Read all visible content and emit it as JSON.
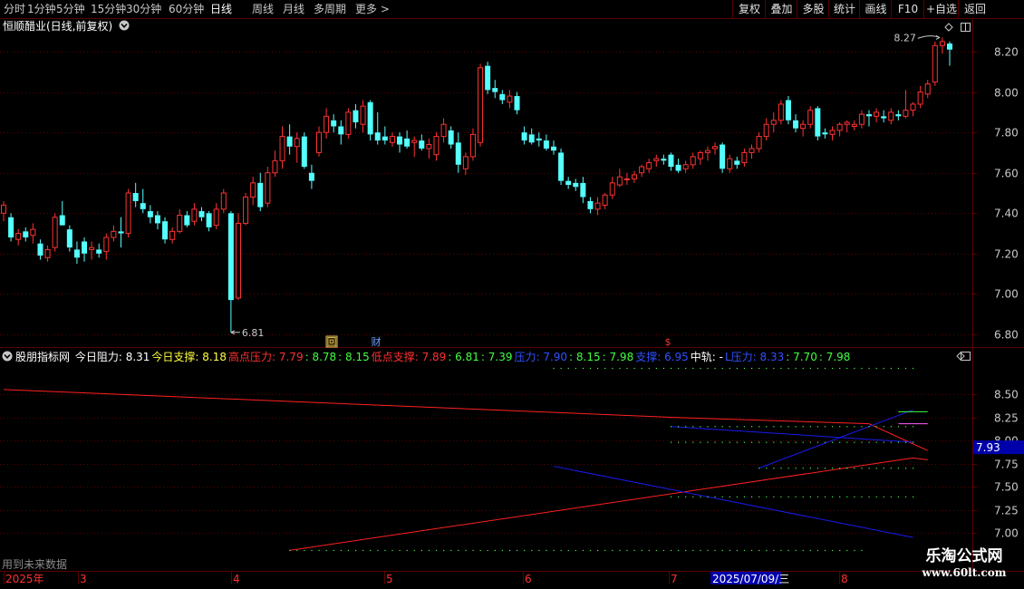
{
  "toolbar": {
    "periods": [
      {
        "label": "分时",
        "active": false
      },
      {
        "label": "1分钟",
        "active": false
      },
      {
        "label": "5分钟",
        "active": false
      },
      {
        "label": "15分钟",
        "active": false
      },
      {
        "label": "30分钟",
        "active": false
      },
      {
        "label": "60分钟",
        "active": false
      },
      {
        "label": "日线",
        "active": true
      },
      {
        "label": "周线",
        "active": false
      },
      {
        "label": "月线",
        "active": false
      },
      {
        "label": "多周期",
        "active": false
      },
      {
        "label": "更多 >",
        "active": false
      }
    ],
    "right_buttons": [
      "复权",
      "叠加",
      "多股",
      "统计",
      "画线",
      "F10",
      "+自选",
      "返回"
    ]
  },
  "stock_title": "恒顺醋业(日线,前复权)",
  "indicator": {
    "name": "股朋指标网",
    "items": [
      {
        "label": "今日阻力: ",
        "value": "8.31",
        "color": "#ffffff"
      },
      {
        "label": "今日支撑: ",
        "value": "8.18",
        "color": "#ffff40"
      },
      {
        "label": "高点压力: ",
        "value": "7.79",
        "color": "#ff3030"
      },
      {
        "label": ": ",
        "value": "8.78",
        "color": "#40ff40"
      },
      {
        "label": ": ",
        "value": "8.15",
        "color": "#40ff40"
      },
      {
        "label": "低点支撑: ",
        "value": "7.89",
        "color": "#ff3030"
      },
      {
        "label": ": ",
        "value": "6.81",
        "color": "#40ff40"
      },
      {
        "label": ": ",
        "value": "7.39",
        "color": "#40ff40"
      },
      {
        "label": "压力: ",
        "value": "7.90",
        "color": "#3050ff"
      },
      {
        "label": ": ",
        "value": "8.15",
        "color": "#40ff40"
      },
      {
        "label": ": ",
        "value": "7.98",
        "color": "#40ff40"
      },
      {
        "label": "支撑: ",
        "value": "6.95",
        "color": "#3050ff"
      },
      {
        "label": "中轨: ",
        "value": "-",
        "color": "#ffffff"
      },
      {
        "label": "L压力: ",
        "value": "8.33",
        "color": "#3050ff"
      },
      {
        "label": ": ",
        "value": "7.70",
        "color": "#40ff40"
      },
      {
        "label": ": ",
        "value": "7.98",
        "color": "#40ff40"
      }
    ],
    "current_value": "7.93"
  },
  "future_note": "用到未来数据",
  "watermark": {
    "title": "乐淘公式网",
    "url": "www.60lt.com"
  },
  "colors": {
    "up": "#ff3232",
    "down": "#54ffff",
    "grid": "#5a0000",
    "axis": "#c8c8c8",
    "accent_blue": "#1a1aee"
  },
  "chart_data": [
    {
      "type": "candlestick",
      "ylim": [
        6.75,
        8.3
      ],
      "y_ticks": [
        "8.20",
        "8.00",
        "7.80",
        "7.60",
        "7.40",
        "7.20",
        "7.00",
        "6.80"
      ],
      "annotations": [
        {
          "label": "6.81"
        },
        {
          "label": "8.27"
        }
      ],
      "event_markers": [
        {
          "label": "回"
        },
        {
          "label": "财"
        },
        {
          "label": "$"
        }
      ],
      "x_labels": [
        "2025年",
        "3",
        "4",
        "5",
        "6",
        "7",
        "2025/07/09/三",
        "8"
      ],
      "candles": [
        {
          "o": 7.4,
          "h": 7.46,
          "l": 7.36,
          "c": 7.44
        },
        {
          "o": 7.38,
          "h": 7.4,
          "l": 7.26,
          "c": 7.28
        },
        {
          "o": 7.27,
          "h": 7.32,
          "l": 7.24,
          "c": 7.3
        },
        {
          "o": 7.31,
          "h": 7.33,
          "l": 7.26,
          "c": 7.28
        },
        {
          "o": 7.29,
          "h": 7.35,
          "l": 7.25,
          "c": 7.32
        },
        {
          "o": 7.25,
          "h": 7.27,
          "l": 7.17,
          "c": 7.19
        },
        {
          "o": 7.18,
          "h": 7.24,
          "l": 7.16,
          "c": 7.22
        },
        {
          "o": 7.23,
          "h": 7.4,
          "l": 7.21,
          "c": 7.38
        },
        {
          "o": 7.39,
          "h": 7.46,
          "l": 7.36,
          "c": 7.34
        },
        {
          "o": 7.32,
          "h": 7.34,
          "l": 7.21,
          "c": 7.23
        },
        {
          "o": 7.22,
          "h": 7.26,
          "l": 7.15,
          "c": 7.18
        },
        {
          "o": 7.26,
          "h": 7.28,
          "l": 7.16,
          "c": 7.2
        },
        {
          "o": 7.22,
          "h": 7.26,
          "l": 7.17,
          "c": 7.23
        },
        {
          "o": 7.22,
          "h": 7.25,
          "l": 7.18,
          "c": 7.2
        },
        {
          "o": 7.21,
          "h": 7.3,
          "l": 7.17,
          "c": 7.28
        },
        {
          "o": 7.28,
          "h": 7.34,
          "l": 7.26,
          "c": 7.31
        },
        {
          "o": 7.31,
          "h": 7.38,
          "l": 7.23,
          "c": 7.3
        },
        {
          "o": 7.3,
          "h": 7.52,
          "l": 7.28,
          "c": 7.5
        },
        {
          "o": 7.5,
          "h": 7.55,
          "l": 7.43,
          "c": 7.46
        },
        {
          "o": 7.45,
          "h": 7.52,
          "l": 7.4,
          "c": 7.42
        },
        {
          "o": 7.41,
          "h": 7.44,
          "l": 7.35,
          "c": 7.38
        },
        {
          "o": 7.39,
          "h": 7.41,
          "l": 7.32,
          "c": 7.35
        },
        {
          "o": 7.36,
          "h": 7.38,
          "l": 7.25,
          "c": 7.27
        },
        {
          "o": 7.27,
          "h": 7.33,
          "l": 7.25,
          "c": 7.31
        },
        {
          "o": 7.31,
          "h": 7.42,
          "l": 7.3,
          "c": 7.39
        },
        {
          "o": 7.39,
          "h": 7.41,
          "l": 7.33,
          "c": 7.34
        },
        {
          "o": 7.36,
          "h": 7.45,
          "l": 7.34,
          "c": 7.42
        },
        {
          "o": 7.41,
          "h": 7.43,
          "l": 7.36,
          "c": 7.38
        },
        {
          "o": 7.4,
          "h": 7.41,
          "l": 7.31,
          "c": 7.33
        },
        {
          "o": 7.34,
          "h": 7.45,
          "l": 7.32,
          "c": 7.42
        },
        {
          "o": 7.42,
          "h": 7.52,
          "l": 7.4,
          "c": 7.5
        },
        {
          "o": 7.4,
          "h": 7.41,
          "l": 6.81,
          "c": 6.97
        },
        {
          "o": 6.98,
          "h": 7.4,
          "l": 6.97,
          "c": 7.35
        },
        {
          "o": 7.35,
          "h": 7.5,
          "l": 7.34,
          "c": 7.48
        },
        {
          "o": 7.48,
          "h": 7.58,
          "l": 7.44,
          "c": 7.55
        },
        {
          "o": 7.55,
          "h": 7.6,
          "l": 7.41,
          "c": 7.43
        },
        {
          "o": 7.45,
          "h": 7.63,
          "l": 7.43,
          "c": 7.6
        },
        {
          "o": 7.6,
          "h": 7.71,
          "l": 7.58,
          "c": 7.66
        },
        {
          "o": 7.66,
          "h": 7.83,
          "l": 7.62,
          "c": 7.78
        },
        {
          "o": 7.78,
          "h": 7.84,
          "l": 7.69,
          "c": 7.73
        },
        {
          "o": 7.73,
          "h": 7.8,
          "l": 7.65,
          "c": 7.77
        },
        {
          "o": 7.78,
          "h": 7.8,
          "l": 7.62,
          "c": 7.63
        },
        {
          "o": 7.6,
          "h": 7.64,
          "l": 7.52,
          "c": 7.56
        },
        {
          "o": 7.7,
          "h": 7.83,
          "l": 7.68,
          "c": 7.8
        },
        {
          "o": 7.8,
          "h": 7.92,
          "l": 7.77,
          "c": 7.88
        },
        {
          "o": 7.86,
          "h": 7.89,
          "l": 7.8,
          "c": 7.83
        },
        {
          "o": 7.83,
          "h": 7.86,
          "l": 7.74,
          "c": 7.79
        },
        {
          "o": 7.79,
          "h": 7.92,
          "l": 7.77,
          "c": 7.9
        },
        {
          "o": 7.91,
          "h": 7.94,
          "l": 7.82,
          "c": 7.85
        },
        {
          "o": 7.84,
          "h": 7.96,
          "l": 7.8,
          "c": 7.93
        },
        {
          "o": 7.95,
          "h": 7.96,
          "l": 7.76,
          "c": 7.79
        },
        {
          "o": 7.8,
          "h": 7.9,
          "l": 7.74,
          "c": 7.76
        },
        {
          "o": 7.78,
          "h": 7.83,
          "l": 7.74,
          "c": 7.76
        },
        {
          "o": 7.75,
          "h": 7.8,
          "l": 7.73,
          "c": 7.78
        },
        {
          "o": 7.78,
          "h": 7.8,
          "l": 7.7,
          "c": 7.74
        },
        {
          "o": 7.77,
          "h": 7.81,
          "l": 7.72,
          "c": 7.73
        },
        {
          "o": 7.75,
          "h": 7.78,
          "l": 7.68,
          "c": 7.76
        },
        {
          "o": 7.76,
          "h": 7.79,
          "l": 7.71,
          "c": 7.72
        },
        {
          "o": 7.72,
          "h": 7.77,
          "l": 7.67,
          "c": 7.74
        },
        {
          "o": 7.69,
          "h": 7.8,
          "l": 7.66,
          "c": 7.78
        },
        {
          "o": 7.78,
          "h": 7.87,
          "l": 7.75,
          "c": 7.84
        },
        {
          "o": 7.81,
          "h": 7.83,
          "l": 7.72,
          "c": 7.74
        },
        {
          "o": 7.75,
          "h": 7.8,
          "l": 7.6,
          "c": 7.64
        },
        {
          "o": 7.62,
          "h": 7.7,
          "l": 7.59,
          "c": 7.68
        },
        {
          "o": 7.68,
          "h": 7.82,
          "l": 7.66,
          "c": 7.79
        },
        {
          "o": 7.75,
          "h": 8.14,
          "l": 7.73,
          "c": 8.12
        },
        {
          "o": 8.13,
          "h": 8.15,
          "l": 7.99,
          "c": 8.01
        },
        {
          "o": 8.02,
          "h": 8.06,
          "l": 7.97,
          "c": 8.0
        },
        {
          "o": 7.99,
          "h": 8.01,
          "l": 7.94,
          "c": 7.96
        },
        {
          "o": 7.95,
          "h": 8.01,
          "l": 7.92,
          "c": 7.98
        },
        {
          "o": 7.98,
          "h": 8.0,
          "l": 7.89,
          "c": 7.91
        },
        {
          "o": 7.8,
          "h": 7.83,
          "l": 7.74,
          "c": 7.76
        },
        {
          "o": 7.79,
          "h": 7.82,
          "l": 7.74,
          "c": 7.75
        },
        {
          "o": 7.77,
          "h": 7.8,
          "l": 7.73,
          "c": 7.76
        },
        {
          "o": 7.76,
          "h": 7.79,
          "l": 7.71,
          "c": 7.72
        },
        {
          "o": 7.73,
          "h": 7.76,
          "l": 7.69,
          "c": 7.71
        },
        {
          "o": 7.7,
          "h": 7.72,
          "l": 7.54,
          "c": 7.56
        },
        {
          "o": 7.56,
          "h": 7.58,
          "l": 7.52,
          "c": 7.54
        },
        {
          "o": 7.55,
          "h": 7.57,
          "l": 7.51,
          "c": 7.53
        },
        {
          "o": 7.55,
          "h": 7.58,
          "l": 7.45,
          "c": 7.48
        },
        {
          "o": 7.46,
          "h": 7.48,
          "l": 7.4,
          "c": 7.42
        },
        {
          "o": 7.42,
          "h": 7.48,
          "l": 7.39,
          "c": 7.45
        },
        {
          "o": 7.44,
          "h": 7.5,
          "l": 7.42,
          "c": 7.49
        },
        {
          "o": 7.49,
          "h": 7.58,
          "l": 7.47,
          "c": 7.55
        },
        {
          "o": 7.54,
          "h": 7.62,
          "l": 7.53,
          "c": 7.58
        },
        {
          "o": 7.57,
          "h": 7.6,
          "l": 7.54,
          "c": 7.57
        },
        {
          "o": 7.57,
          "h": 7.61,
          "l": 7.55,
          "c": 7.59
        },
        {
          "o": 7.6,
          "h": 7.64,
          "l": 7.58,
          "c": 7.63
        },
        {
          "o": 7.62,
          "h": 7.67,
          "l": 7.6,
          "c": 7.65
        },
        {
          "o": 7.66,
          "h": 7.69,
          "l": 7.63,
          "c": 7.67
        },
        {
          "o": 7.67,
          "h": 7.69,
          "l": 7.64,
          "c": 7.66
        },
        {
          "o": 7.69,
          "h": 7.7,
          "l": 7.61,
          "c": 7.63
        },
        {
          "o": 7.64,
          "h": 7.67,
          "l": 7.6,
          "c": 7.61
        },
        {
          "o": 7.62,
          "h": 7.66,
          "l": 7.6,
          "c": 7.64
        },
        {
          "o": 7.64,
          "h": 7.7,
          "l": 7.62,
          "c": 7.68
        },
        {
          "o": 7.67,
          "h": 7.71,
          "l": 7.64,
          "c": 7.7
        },
        {
          "o": 7.7,
          "h": 7.73,
          "l": 7.66,
          "c": 7.71
        },
        {
          "o": 7.72,
          "h": 7.75,
          "l": 7.69,
          "c": 7.73
        },
        {
          "o": 7.74,
          "h": 7.75,
          "l": 7.6,
          "c": 7.62
        },
        {
          "o": 7.62,
          "h": 7.69,
          "l": 7.6,
          "c": 7.67
        },
        {
          "o": 7.66,
          "h": 7.68,
          "l": 7.62,
          "c": 7.64
        },
        {
          "o": 7.65,
          "h": 7.72,
          "l": 7.63,
          "c": 7.7
        },
        {
          "o": 7.7,
          "h": 7.74,
          "l": 7.67,
          "c": 7.72
        },
        {
          "o": 7.72,
          "h": 7.8,
          "l": 7.7,
          "c": 7.78
        },
        {
          "o": 7.78,
          "h": 7.87,
          "l": 7.76,
          "c": 7.84
        },
        {
          "o": 7.84,
          "h": 7.9,
          "l": 7.8,
          "c": 7.86
        },
        {
          "o": 7.86,
          "h": 7.96,
          "l": 7.84,
          "c": 7.94
        },
        {
          "o": 7.96,
          "h": 7.98,
          "l": 7.84,
          "c": 7.86
        },
        {
          "o": 7.86,
          "h": 7.89,
          "l": 7.8,
          "c": 7.82
        },
        {
          "o": 7.82,
          "h": 7.86,
          "l": 7.78,
          "c": 7.84
        },
        {
          "o": 7.84,
          "h": 7.93,
          "l": 7.82,
          "c": 7.91
        },
        {
          "o": 7.92,
          "h": 7.93,
          "l": 7.76,
          "c": 7.78
        },
        {
          "o": 7.8,
          "h": 7.82,
          "l": 7.77,
          "c": 7.79
        },
        {
          "o": 7.79,
          "h": 7.83,
          "l": 7.76,
          "c": 7.81
        },
        {
          "o": 7.81,
          "h": 7.85,
          "l": 7.78,
          "c": 7.84
        },
        {
          "o": 7.84,
          "h": 7.86,
          "l": 7.8,
          "c": 7.85
        },
        {
          "o": 7.83,
          "h": 7.86,
          "l": 7.81,
          "c": 7.84
        },
        {
          "o": 7.84,
          "h": 7.91,
          "l": 7.82,
          "c": 7.89
        },
        {
          "o": 7.89,
          "h": 7.91,
          "l": 7.83,
          "c": 7.88
        },
        {
          "o": 7.88,
          "h": 7.92,
          "l": 7.85,
          "c": 7.9
        },
        {
          "o": 7.88,
          "h": 7.91,
          "l": 7.85,
          "c": 7.87
        },
        {
          "o": 7.86,
          "h": 7.92,
          "l": 7.84,
          "c": 7.9
        },
        {
          "o": 7.89,
          "h": 7.91,
          "l": 7.86,
          "c": 7.88
        },
        {
          "o": 7.88,
          "h": 8.01,
          "l": 7.87,
          "c": 7.91
        },
        {
          "o": 7.91,
          "h": 7.95,
          "l": 7.88,
          "c": 7.94
        },
        {
          "o": 7.94,
          "h": 8.03,
          "l": 7.92,
          "c": 8.0
        },
        {
          "o": 7.99,
          "h": 8.06,
          "l": 7.97,
          "c": 8.04
        },
        {
          "o": 8.05,
          "h": 8.25,
          "l": 8.03,
          "c": 8.23
        },
        {
          "o": 8.23,
          "h": 8.27,
          "l": 8.19,
          "c": 8.25
        },
        {
          "o": 8.24,
          "h": 8.25,
          "l": 8.13,
          "c": 8.21
        }
      ]
    },
    {
      "type": "line",
      "ylim": [
        6.9,
        8.8
      ],
      "y_ticks": [
        "8.50",
        "8.25",
        "8.00",
        "7.75",
        "7.50",
        "7.25",
        "7.00"
      ],
      "series": [
        {
          "kind": "line",
          "color": "#ff2020",
          "points": [
            [
              0,
              8.55
            ],
            [
              91,
              8.25
            ],
            [
              118,
              8.18
            ],
            [
              126,
              7.89
            ]
          ]
        },
        {
          "kind": "line",
          "color": "#ff2020",
          "points": [
            [
              39,
              6.81
            ],
            [
              124,
              7.81
            ],
            [
              126,
              7.79
            ]
          ]
        },
        {
          "kind": "line",
          "color": "#1a1aee",
          "points": [
            [
              75,
              7.72
            ],
            [
              124,
              6.95
            ]
          ]
        },
        {
          "kind": "line",
          "color": "#1a1aee",
          "points": [
            [
              91,
              8.15
            ],
            [
              124,
              7.98
            ]
          ]
        },
        {
          "kind": "line",
          "color": "#1a1aee",
          "points": [
            [
              103,
              7.7
            ],
            [
              124,
              8.33
            ]
          ]
        },
        {
          "kind": "line",
          "color": "#ff60ff",
          "points": [
            [
              122,
              8.18
            ],
            [
              126,
              8.18
            ]
          ]
        },
        {
          "kind": "line",
          "color": "#40ff40",
          "points": [
            [
              122,
              8.31
            ],
            [
              126,
              8.31
            ]
          ]
        },
        {
          "kind": "dots",
          "color": "#40ff40",
          "from": 91,
          "to": 124,
          "y": 8.15
        },
        {
          "kind": "dots",
          "color": "#40ff40",
          "from": 91,
          "to": 124,
          "y": 7.98
        },
        {
          "kind": "dots",
          "color": "#40ff40",
          "from": 103,
          "to": 124,
          "y": 7.7
        },
        {
          "kind": "dots",
          "color": "#40ff40",
          "from": 91,
          "to": 124,
          "y": 7.39
        },
        {
          "kind": "dots",
          "color": "#40ff40",
          "from": 39,
          "to": 117,
          "y": 6.81
        },
        {
          "kind": "dots",
          "color": "#40ff40",
          "from": 75,
          "to": 124,
          "y": 8.78
        }
      ]
    }
  ]
}
